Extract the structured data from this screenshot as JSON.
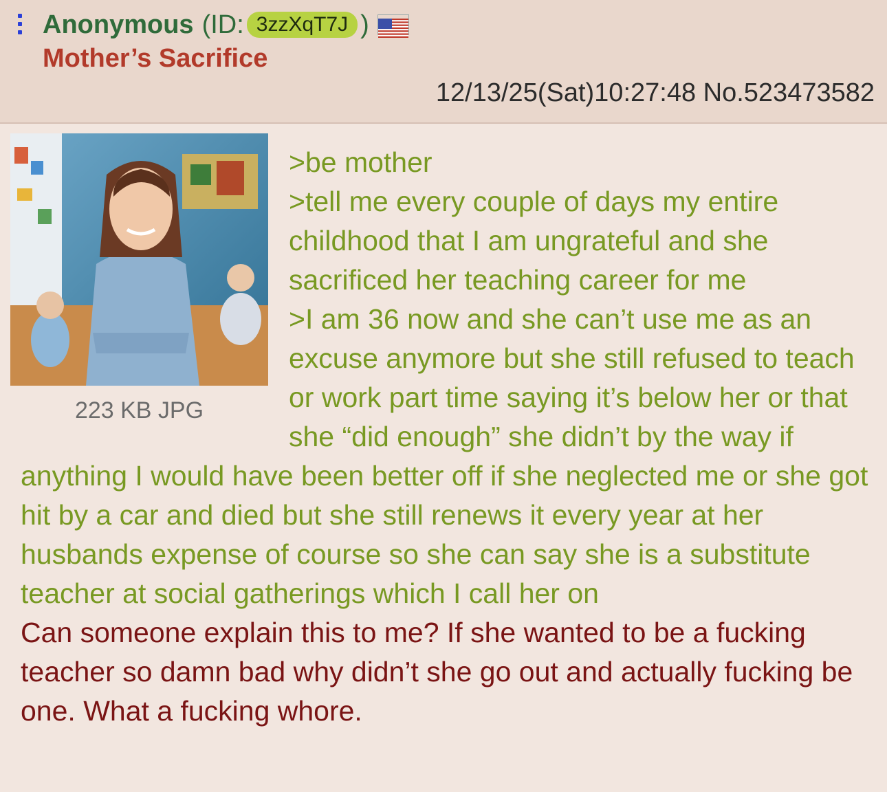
{
  "post": {
    "name": "Anonymous",
    "id_open": "(ID:",
    "id_value": "3zzXqT7J",
    "id_close": ")",
    "flag_icon": "us-flag-icon",
    "subject": "Mother’s Sacrifice",
    "datetime": "12/13/25(Sat)10:27:48",
    "post_number": "No.523473582",
    "file": {
      "size_type": "223 KB JPG"
    },
    "greentext_lines": [
      ">be mother",
      ">tell me every couple of days my entire childhood that I am ungrateful and she sacrificed her teaching career for me",
      ">I am 36 now and she can’t use me as an excuse anymore but she still refused to teach or work part time saying it’s below her or that she “did enough” she didn’t by the way if anything I would have been better off if she neglected me or she got hit by a car and died but she still renews it every year at her husbands expense of course so she can say she is a substitute teacher at social gatherings which I call her on"
    ],
    "comment": "Can someone explain this to me? If she wanted to be a fucking teacher so damn bad why didn’t she go out and actually fucking be one. What a fucking whore."
  },
  "colors": {
    "header_bg": "#e9d7cc",
    "body_bg": "#f2e6df",
    "name": "#2f6b3a",
    "subject": "#b23a2a",
    "greentext": "#789922",
    "comment": "#7a1414",
    "id_badge": "#b7d242"
  }
}
